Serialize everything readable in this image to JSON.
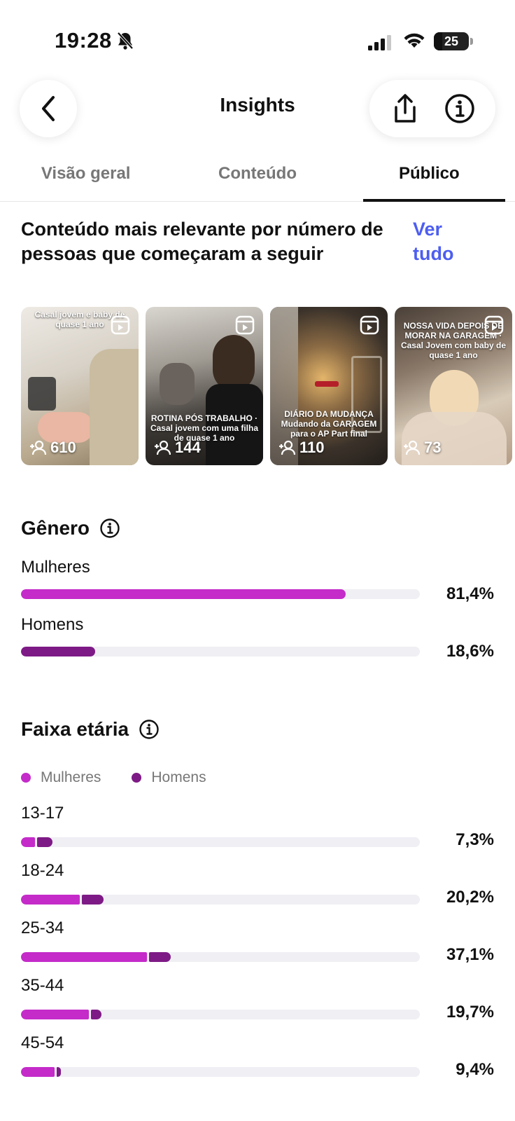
{
  "status_bar": {
    "time": "19:28",
    "battery": "25"
  },
  "header": {
    "title": "Insights"
  },
  "tabs": [
    {
      "label": "Visão geral",
      "active": false
    },
    {
      "label": "Conteúdo",
      "active": false
    },
    {
      "label": "Público",
      "active": true
    }
  ],
  "relevant": {
    "heading": "Conteúdo mais relevante por número de pessoas que começaram a seguir",
    "see_all": "Ver tudo",
    "items": [
      {
        "caption": "Casal jovem e baby de quase 1 ano",
        "count": "610"
      },
      {
        "caption": "ROTINA PÓS TRABALHO · Casal jovem com uma filha de quase 1 ano",
        "count": "144"
      },
      {
        "caption": "DIÁRIO DA MUDANÇA Mudando da GARAGEM para o AP Part final",
        "count": "110"
      },
      {
        "caption": "NOSSA VIDA DEPOIS DE MORAR NA GARAGEM · Casal Jovem com baby de quase 1 ano",
        "count": "73"
      }
    ]
  },
  "gender": {
    "title": "Gênero",
    "rows": [
      {
        "label": "Mulheres",
        "value": "81,4%",
        "fraction": 0.814,
        "color": "#c42bc9"
      },
      {
        "label": "Homens",
        "value": "18,6%",
        "fraction": 0.186,
        "color": "#7e1a86"
      }
    ]
  },
  "age": {
    "title": "Faixa etária",
    "legend": [
      {
        "label": "Mulheres",
        "color": "#c42bc9"
      },
      {
        "label": "Homens",
        "color": "#7e1a86"
      }
    ],
    "rows": [
      {
        "label": "13-17",
        "value": "7,3%",
        "women": 0.035,
        "men": 0.038
      },
      {
        "label": "18-24",
        "value": "20,2%",
        "women": 0.148,
        "men": 0.054
      },
      {
        "label": "25-34",
        "value": "37,1%",
        "women": 0.316,
        "men": 0.055
      },
      {
        "label": "35-44",
        "value": "19,7%",
        "women": 0.171,
        "men": 0.026
      },
      {
        "label": "45-54",
        "value": "9,4%",
        "women": 0.084,
        "men": 0.01
      }
    ]
  }
}
